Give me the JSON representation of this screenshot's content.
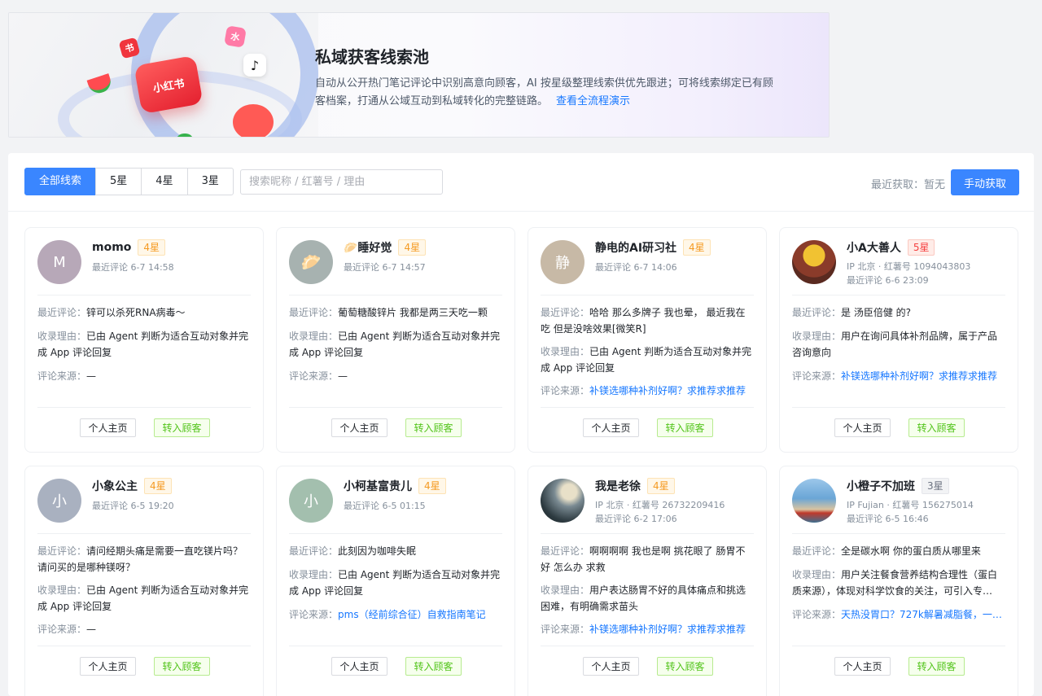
{
  "banner": {
    "title": "私域获客线索池",
    "description": "自动从公开热门笔记评论中识别高意向顾客，AI 按星级整理线索供优先跟进；可将线索绑定已有顾客档案，打通从公域互动到私域转化的完整链路。",
    "link": "查看全流程演示",
    "art_logo_text": "小红书",
    "art_chip_a": "书",
    "art_chip_b": "水",
    "art_chip_c": "♪"
  },
  "toolbar": {
    "tabs": [
      "全部线索",
      "5星",
      "4星",
      "3星"
    ],
    "search_placeholder": "搜索昵称 / 红薯号 / 理由",
    "recent_fetch": "最近获取：暂无",
    "fetch_button": "手动获取"
  },
  "labels": {
    "comment": "最近评论：",
    "reason": "收录理由：",
    "source": "评论来源：",
    "profile_button": "个人主页",
    "convert_button": "转入顾客"
  },
  "cards": [
    {
      "avatar": "M",
      "name": "momo",
      "star": "4星",
      "meta1": "最近评论 6-7 14:58",
      "comment": "锌可以杀死RNA病毒～",
      "reason": "已由 Agent 判断为适合互动对象并完成 App 评论回复",
      "source": "—"
    },
    {
      "avatar": "🥟",
      "name": "🥟睡好觉",
      "star": "4星",
      "meta1": "最近评论 6-7 14:57",
      "comment": "葡萄糖酸锌片 我都是两三天吃一颗",
      "reason": "已由 Agent 判断为适合互动对象并完成 App 评论回复",
      "source": "—"
    },
    {
      "avatar": "静",
      "name": "静电的AI研习社",
      "star": "4星",
      "meta1": "最近评论 6-7 14:06",
      "comment": "哈哈 那么多牌子 我也晕， 最近我在吃 但是没啥效果[微笑R]",
      "reason": "已由 Agent 判断为适合互动对象并完成 App 评论回复",
      "source": "补镁选哪种补剂好啊？求推荐求推荐"
    },
    {
      "avatar": "",
      "name": "小A大善人",
      "star": "5星",
      "meta1": "IP 北京 · 红薯号 1094043803",
      "meta2": "最近评论 6-6 23:09",
      "comment": "是 汤臣倍健 的?",
      "reason": "用户在询问具体补剂品牌，属于产品咨询意向",
      "source": "补镁选哪种补剂好啊？求推荐求推荐"
    },
    {
      "avatar": "小",
      "name": "小象公主",
      "star": "4星",
      "meta1": "最近评论 6-5 19:20",
      "comment": "请问经期头痛是需要一直吃镁片吗？请问买的是哪种镁呀？",
      "reason": "已由 Agent 判断为适合互动对象并完成 App 评论回复",
      "source": "—"
    },
    {
      "avatar": "小",
      "name": "小柯基富贵儿",
      "star": "4星",
      "meta1": "最近评论 6-5 01:15",
      "comment": "此刻因为咖啡失眠",
      "reason": "已由 Agent 判断为适合互动对象并完成 App 评论回复",
      "source": "pms（经前综合征）自救指南笔记"
    },
    {
      "avatar": "",
      "name": "我是老徐",
      "star": "4星",
      "meta1": "IP 北京 · 红薯号 26732209416",
      "meta2": "最近评论 6-2 17:06",
      "comment": "啊啊啊啊 我也是啊 挑花眼了 肠胃不好 怎么办 求救",
      "reason": "用户表达肠胃不好的具体痛点和挑选困难，有明确需求苗头",
      "source": "补镁选哪种补剂好啊？求推荐求推荐"
    },
    {
      "avatar": "",
      "name": "小橙子不加班",
      "star": "3星",
      "meta1": "IP Fujian · 红薯号 156275014",
      "meta2": "最近评论 6-5 16:46",
      "comment": "全是碳水啊 你的蛋白质从哪里来",
      "reason": "用户关注餐食营养结构合理性（蛋白质来源），体现对科学饮食的关注，可引入专…",
      "source": "天热没胃口？727k解暑减脂餐，一…"
    }
  ],
  "colors": {
    "primary": "#3a86ff",
    "link": "#1677ff",
    "star4": "#f59a23",
    "star5": "#f53f3f",
    "star3": "#6b7280",
    "convert": "#52c41a"
  }
}
